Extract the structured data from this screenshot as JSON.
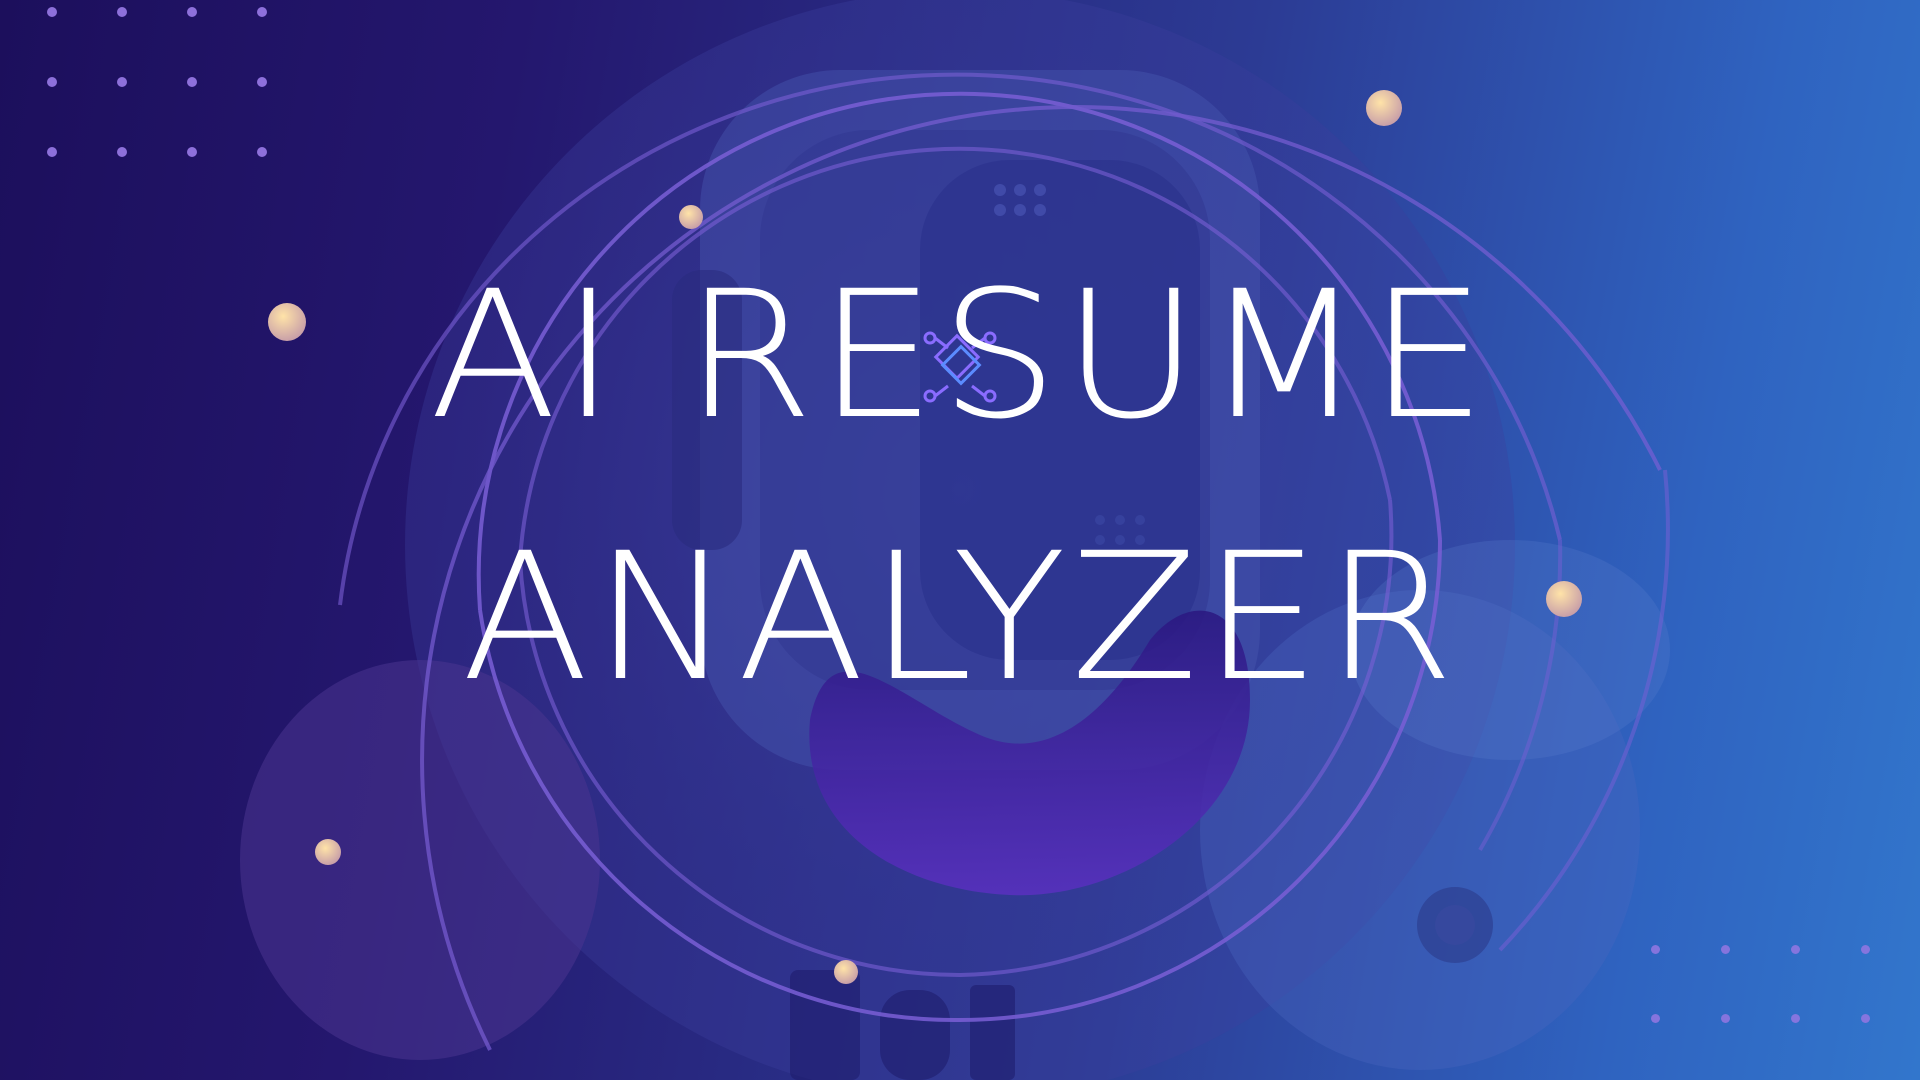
{
  "hero": {
    "title_line_1": "AI RESUME",
    "title_line_2": "ANALYZER"
  },
  "colors": {
    "background_left": "#1c0f5c",
    "background_right": "#3276cc",
    "title_text": "#ffffff",
    "ring_stroke": "#7a5fd6",
    "accent_dot": "#e8c27a",
    "logo_accent": "#8a6cff"
  },
  "icons": {
    "center_logo": "diamond-circuit-logo-icon",
    "decor_dots": "gold-orb-icon"
  }
}
